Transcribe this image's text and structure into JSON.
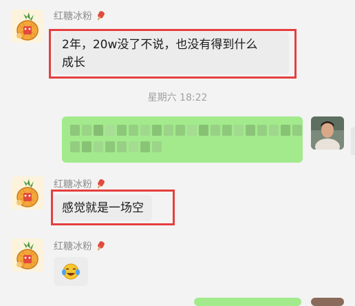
{
  "messages": [
    {
      "sender": "红糖冰粉",
      "text_line1": "2年，20w没了不说，也没有得到什么",
      "text_line2": "成长"
    },
    {
      "sender": "红糖冰粉",
      "text": "感觉就是一场空"
    },
    {
      "sender": "红糖冰粉",
      "emoji": "laughing-crying-emoji"
    }
  ],
  "timestamp": "星期六 18:22",
  "icons": {
    "left_avatar": "pineapple-cartoon-avatar",
    "right_avatar": "user-photo-avatar",
    "name_badge": "popsicle-icon"
  },
  "colors": {
    "background": "#f3f3f3",
    "incoming_bubble": "#ececec",
    "outgoing_bubble": "#a2ea8c",
    "highlight": "#e53e3e",
    "name_text": "#8d8d8d"
  }
}
